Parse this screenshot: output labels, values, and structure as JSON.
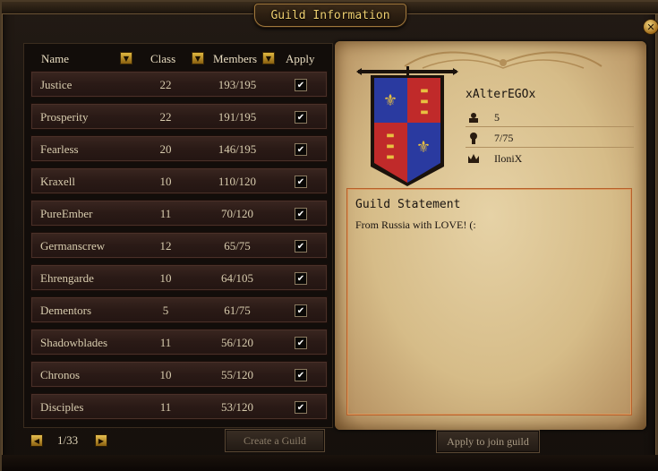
{
  "window": {
    "title": "Guild Information"
  },
  "table": {
    "headers": {
      "name": "Name",
      "class": "Class",
      "members": "Members",
      "apply": "Apply"
    },
    "rows": [
      {
        "name": "Justice",
        "class": "22",
        "members": "193/195",
        "apply": "✔"
      },
      {
        "name": "Prosperity",
        "class": "22",
        "members": "191/195",
        "apply": "✔"
      },
      {
        "name": "Fearless",
        "class": "20",
        "members": "146/195",
        "apply": "✔"
      },
      {
        "name": "Kraxell",
        "class": "10",
        "members": "110/120",
        "apply": "✔"
      },
      {
        "name": "PureEmber",
        "class": "11",
        "members": "70/120",
        "apply": "✔"
      },
      {
        "name": "Germanscrew",
        "class": "12",
        "members": "65/75",
        "apply": "✔"
      },
      {
        "name": "Ehrengarde",
        "class": "10",
        "members": "64/105",
        "apply": "✔"
      },
      {
        "name": "Dementors",
        "class": "5",
        "members": "61/75",
        "apply": "✔"
      },
      {
        "name": "Shadowblades",
        "class": "11",
        "members": "56/120",
        "apply": "✔"
      },
      {
        "name": "Chronos",
        "class": "10",
        "members": "55/120",
        "apply": "✔"
      },
      {
        "name": "Disciples",
        "class": "11",
        "members": "53/120",
        "apply": "✔"
      }
    ]
  },
  "pager": {
    "current": "1/33"
  },
  "buttons": {
    "create_guild": "Create a Guild",
    "apply_join": "Apply to join guild"
  },
  "guild_detail": {
    "name": "xAlterEGOx",
    "class": "5",
    "members": "7/75",
    "leader": "IloniX",
    "statement_title": "Guild Statement",
    "statement_text": "From Russia with LOVE! (:"
  },
  "icons": {
    "close": "close-icon",
    "dropdown": "chevron-down-icon",
    "prev": "arrow-left-icon",
    "next": "arrow-right-icon",
    "class": "class-icon",
    "members": "member-icon",
    "leader": "crown-icon"
  },
  "colors": {
    "title_gold": "#f0d070",
    "row_bg": "#2a1a16",
    "parchment": "#d6bc88",
    "statement_border": "#b8602a"
  }
}
